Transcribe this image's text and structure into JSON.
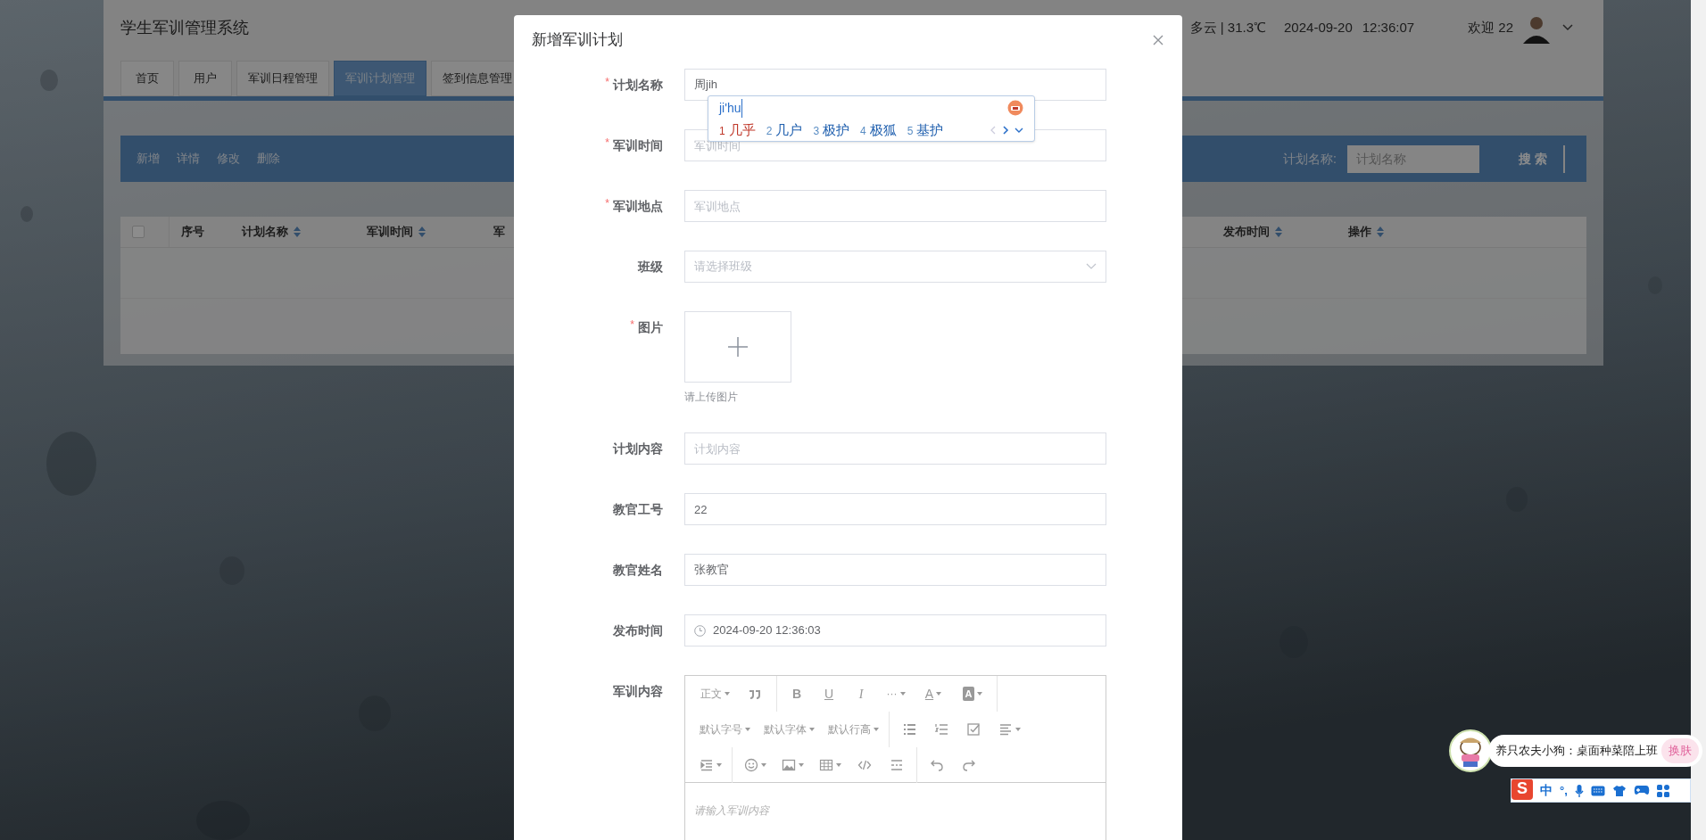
{
  "app": {
    "title": "学生军训管理系统",
    "weather": "多云 | 31.3℃",
    "date": "2024-09-20",
    "time": "12:36:07",
    "welcome": "欢迎 22"
  },
  "tabs": [
    {
      "label": "首页",
      "selected": false
    },
    {
      "label": "用户",
      "selected": false
    },
    {
      "label": "军训日程管理",
      "selected": false
    },
    {
      "label": "军训计划管理",
      "selected": true
    },
    {
      "label": "签到信息管理",
      "selected": false
    }
  ],
  "toolbar": {
    "actions": [
      "新增",
      "详情",
      "修改",
      "删除"
    ],
    "search_label": "计划名称:",
    "search_placeholder": "计划名称",
    "search_button": "搜 索"
  },
  "table": {
    "select_all": {
      "checked": false
    },
    "columns": [
      {
        "label": "序号",
        "sortable": false
      },
      {
        "label": "计划名称",
        "sortable": true
      },
      {
        "label": "军训时间",
        "sortable": true
      },
      {
        "label": "军",
        "sortable": false
      },
      {
        "label": "发布时间",
        "sortable": true
      },
      {
        "label": "操作",
        "sortable": true
      }
    ]
  },
  "dialog": {
    "title": "新增军训计划",
    "required_mark": "*",
    "fields": [
      {
        "kind": "text",
        "label": "计划名称",
        "required": true,
        "value": "周jih"
      },
      {
        "kind": "text",
        "label": "军训时间",
        "required": true,
        "placeholder": "军训时间"
      },
      {
        "kind": "text",
        "label": "军训地点",
        "required": true,
        "placeholder": "军训地点"
      },
      {
        "kind": "select",
        "label": "班级",
        "required": false,
        "placeholder": "请选择班级"
      },
      {
        "kind": "upload",
        "label": "图片",
        "required": true,
        "hint": "请上传图片"
      },
      {
        "kind": "text",
        "label": "计划内容",
        "required": false,
        "placeholder": "计划内容"
      },
      {
        "kind": "text",
        "label": "教官工号",
        "required": false,
        "value": "22"
      },
      {
        "kind": "text",
        "label": "教官姓名",
        "required": false,
        "value": "张教官"
      },
      {
        "kind": "datetime",
        "label": "发布时间",
        "required": false,
        "value": "2024-09-20 12:36:03"
      },
      {
        "kind": "editor",
        "label": "军训内容",
        "required": false,
        "placeholder": "请输入军训内容"
      }
    ],
    "editor_tools": [
      "正文",
      "B",
      "U",
      "I",
      "···",
      "A",
      "A",
      "默认字号",
      "默认字体",
      "默认行高"
    ]
  },
  "ime": {
    "pinyin": "ji'hu",
    "candidates": [
      {
        "index": "1",
        "text": "几乎",
        "selected": true
      },
      {
        "index": "2",
        "text": "几户",
        "selected": false
      },
      {
        "index": "3",
        "text": "极护",
        "selected": false
      },
      {
        "index": "4",
        "text": "极狐",
        "selected": false
      },
      {
        "index": "5",
        "text": "基护",
        "selected": false
      }
    ]
  },
  "ime_bar": {
    "tip": "养只农夫小狗：桌面种菜陪上班",
    "skin_button": "换肤",
    "logo": "S",
    "mode": "中",
    "punctuation": "°,"
  }
}
